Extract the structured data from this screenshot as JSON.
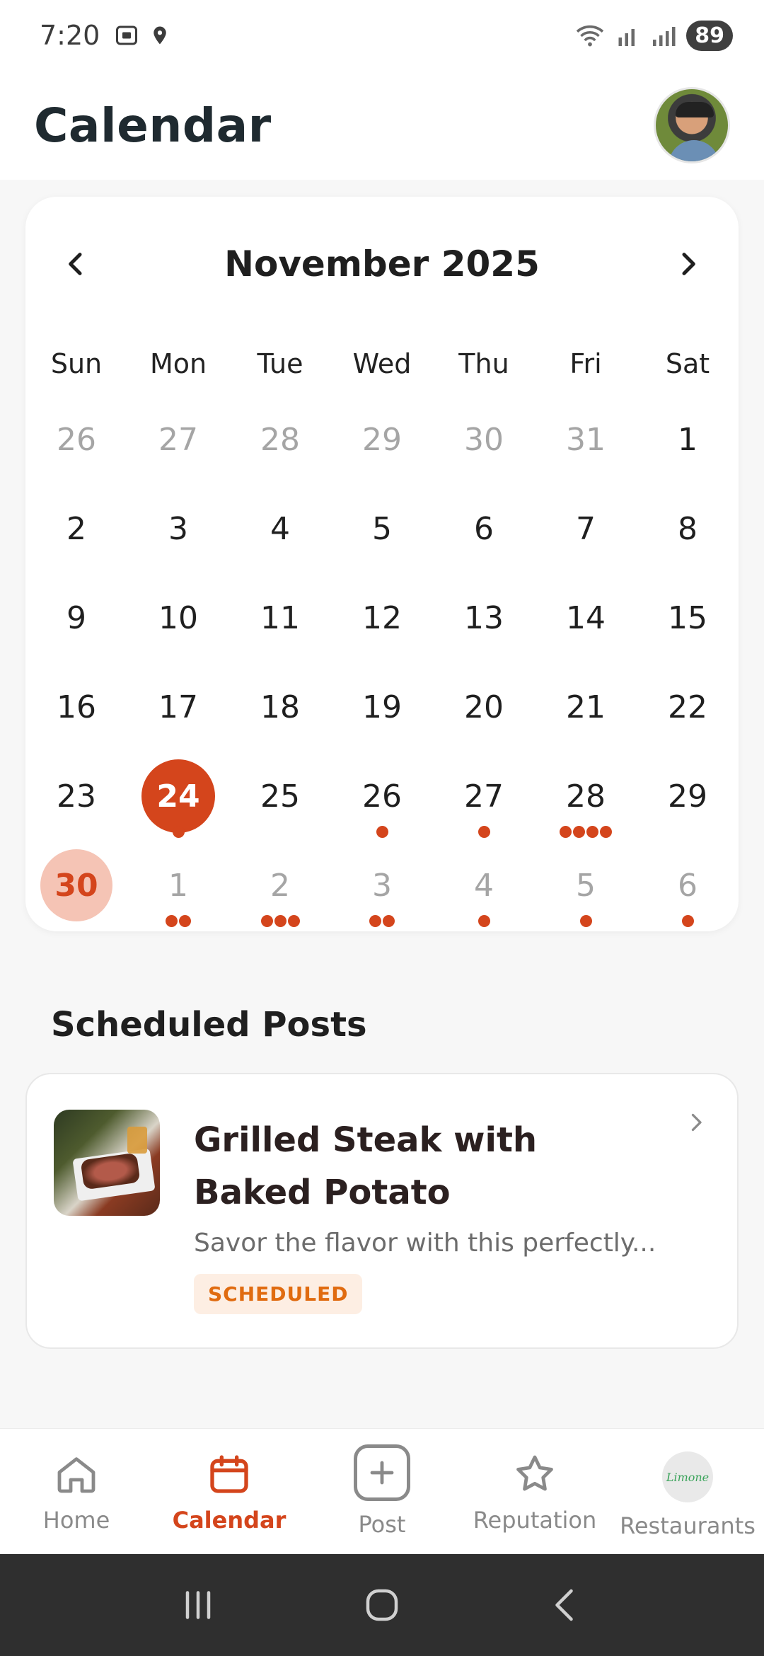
{
  "status_bar": {
    "time": "7:20",
    "battery": "89"
  },
  "header": {
    "title": "Calendar"
  },
  "calendar": {
    "month_label": "November 2025",
    "weekdays": [
      "Sun",
      "Mon",
      "Tue",
      "Wed",
      "Thu",
      "Fri",
      "Sat"
    ],
    "weeks": [
      [
        {
          "day": "26",
          "muted": true,
          "dots": 0
        },
        {
          "day": "27",
          "muted": true,
          "dots": 0
        },
        {
          "day": "28",
          "muted": true,
          "dots": 0
        },
        {
          "day": "29",
          "muted": true,
          "dots": 0
        },
        {
          "day": "30",
          "muted": true,
          "dots": 0
        },
        {
          "day": "31",
          "muted": true,
          "dots": 0
        },
        {
          "day": "1",
          "muted": false,
          "dots": 0
        }
      ],
      [
        {
          "day": "2",
          "muted": false,
          "dots": 0
        },
        {
          "day": "3",
          "muted": false,
          "dots": 0
        },
        {
          "day": "4",
          "muted": false,
          "dots": 0
        },
        {
          "day": "5",
          "muted": false,
          "dots": 0
        },
        {
          "day": "6",
          "muted": false,
          "dots": 0
        },
        {
          "day": "7",
          "muted": false,
          "dots": 0
        },
        {
          "day": "8",
          "muted": false,
          "dots": 0
        }
      ],
      [
        {
          "day": "9",
          "muted": false,
          "dots": 0
        },
        {
          "day": "10",
          "muted": false,
          "dots": 0
        },
        {
          "day": "11",
          "muted": false,
          "dots": 0
        },
        {
          "day": "12",
          "muted": false,
          "dots": 0
        },
        {
          "day": "13",
          "muted": false,
          "dots": 0
        },
        {
          "day": "14",
          "muted": false,
          "dots": 0
        },
        {
          "day": "15",
          "muted": false,
          "dots": 0
        }
      ],
      [
        {
          "day": "16",
          "muted": false,
          "dots": 0
        },
        {
          "day": "17",
          "muted": false,
          "dots": 0
        },
        {
          "day": "18",
          "muted": false,
          "dots": 0
        },
        {
          "day": "19",
          "muted": false,
          "dots": 0
        },
        {
          "day": "20",
          "muted": false,
          "dots": 0
        },
        {
          "day": "21",
          "muted": false,
          "dots": 0
        },
        {
          "day": "22",
          "muted": false,
          "dots": 0
        }
      ],
      [
        {
          "day": "23",
          "muted": false,
          "dots": 0
        },
        {
          "day": "24",
          "muted": false,
          "dots": 1,
          "selected": true
        },
        {
          "day": "25",
          "muted": false,
          "dots": 0
        },
        {
          "day": "26",
          "muted": false,
          "dots": 1
        },
        {
          "day": "27",
          "muted": false,
          "dots": 1
        },
        {
          "day": "28",
          "muted": false,
          "dots": 4
        },
        {
          "day": "29",
          "muted": false,
          "dots": 0
        }
      ],
      [
        {
          "day": "30",
          "muted": false,
          "dots": 0,
          "today": true
        },
        {
          "day": "1",
          "muted": true,
          "dots": 2
        },
        {
          "day": "2",
          "muted": true,
          "dots": 3
        },
        {
          "day": "3",
          "muted": true,
          "dots": 2
        },
        {
          "day": "4",
          "muted": true,
          "dots": 1
        },
        {
          "day": "5",
          "muted": true,
          "dots": 1
        },
        {
          "day": "6",
          "muted": true,
          "dots": 1
        }
      ]
    ]
  },
  "scheduled": {
    "section_title": "Scheduled Posts",
    "posts": [
      {
        "title": "Grilled Steak with Baked Potato",
        "description": "Savor the flavor with this perfectly...",
        "status": "SCHEDULED"
      }
    ]
  },
  "bottom_nav": {
    "items": [
      {
        "label": "Home",
        "icon": "home-icon"
      },
      {
        "label": "Calendar",
        "icon": "calendar-icon",
        "active": true
      },
      {
        "label": "Post",
        "icon": "plus-icon"
      },
      {
        "label": "Reputation",
        "icon": "star-icon"
      },
      {
        "label": "Restaurants",
        "icon": "restaurant-logo",
        "logo_text": "Limone"
      }
    ]
  },
  "colors": {
    "accent": "#d4451c",
    "today_bg": "#f5c4b5",
    "badge_bg": "#fdeee3",
    "badge_text": "#e06b10"
  }
}
